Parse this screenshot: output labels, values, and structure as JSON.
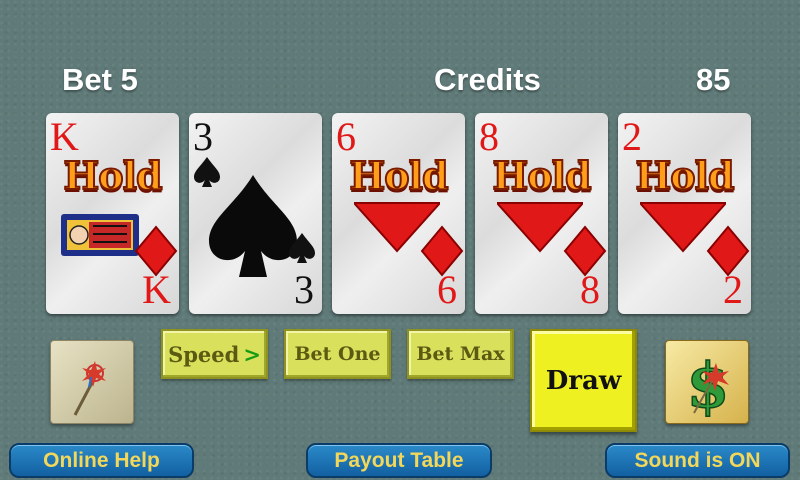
{
  "hud": {
    "bet_label": "Bet  5",
    "credits_label": "Credits",
    "credits_value": "85"
  },
  "cards": [
    {
      "rank": "K",
      "suit": "diamonds",
      "color": "#e01818",
      "held": true,
      "hold_label": "Hold"
    },
    {
      "rank": "3",
      "suit": "spades",
      "color": "#111111",
      "held": false,
      "hold_label": ""
    },
    {
      "rank": "6",
      "suit": "diamonds",
      "color": "#e01818",
      "held": true,
      "hold_label": "Hold"
    },
    {
      "rank": "8",
      "suit": "diamonds",
      "color": "#e01818",
      "held": true,
      "hold_label": "Hold"
    },
    {
      "rank": "2",
      "suit": "diamonds",
      "color": "#e01818",
      "held": true,
      "hold_label": "Hold"
    }
  ],
  "controls": {
    "speed_label": "Speed",
    "speed_arrow": ">",
    "bet_one_label": "Bet One",
    "bet_max_label": "Bet Max",
    "draw_label": "Draw",
    "wand_icon": "magic-wand-icon",
    "dollar_icon": "dollar-sign-icon"
  },
  "footer": {
    "online_help_label": "Online Help",
    "payout_table_label": "Payout Table",
    "sound_label": "Sound is ON"
  },
  "colors": {
    "felt": "#5f7a78",
    "button_lime": "#d8e05c",
    "draw_yellow": "#eef021",
    "footer_blue": "#1f78b8",
    "footer_text": "#f2d75a",
    "hold_orange": "#ff9e1a"
  }
}
